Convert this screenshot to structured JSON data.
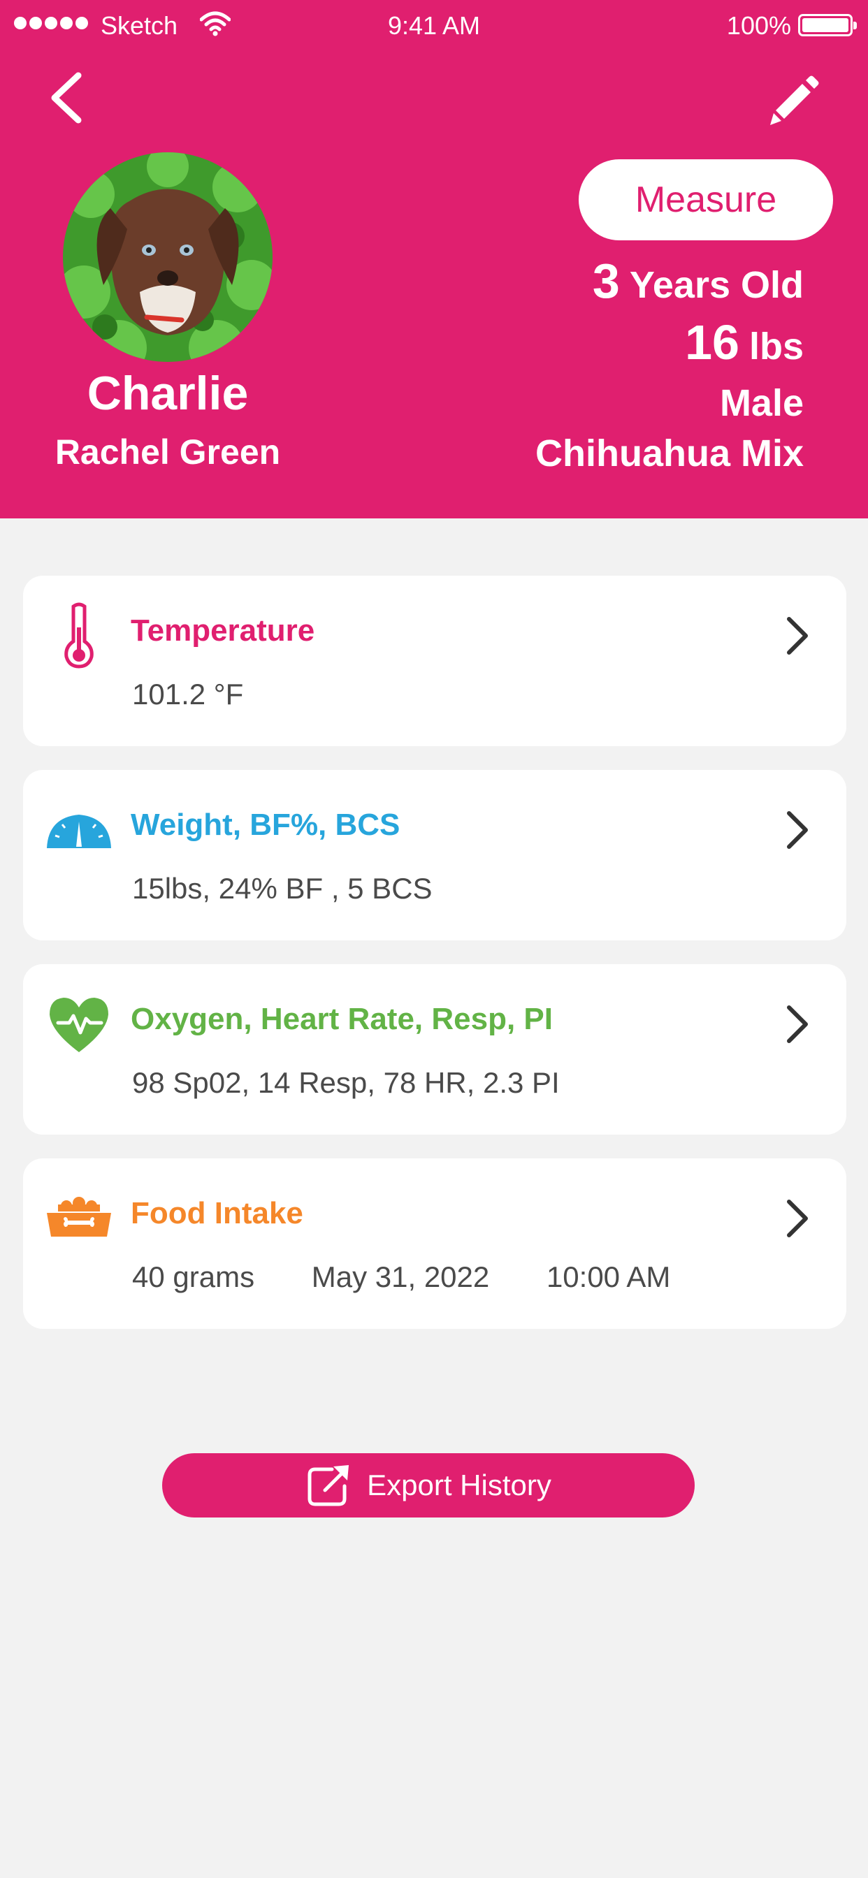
{
  "status_bar": {
    "carrier": "Sketch",
    "time": "9:41 AM",
    "battery": "100%"
  },
  "header": {
    "background": "#e01f6f",
    "measure_label": "Measure",
    "pet": {
      "name": "Charlie",
      "owner": "Rachel Green",
      "age_number": "3",
      "age_unit": "Years Old",
      "weight_number": "16",
      "weight_unit": "lbs",
      "sex": "Male",
      "breed": "Chihuahua Mix"
    }
  },
  "cards": [
    {
      "title": "Temperature",
      "detail": "101.2 °F",
      "icon": "thermometer-icon",
      "color": "#e01f6f"
    },
    {
      "title": "Weight, BF%, BCS",
      "detail": "15lbs, 24% BF , 5 BCS",
      "icon": "scale-gauge-icon",
      "color": "#27a5dc"
    },
    {
      "title": "Oxygen, Heart Rate, Resp, PI",
      "detail": "98 Sp02, 14 Resp, 78 HR, 2.3 PI",
      "icon": "heart-pulse-icon",
      "color": "#62b346"
    },
    {
      "title": "Food Intake",
      "detail": "40 grams       May 31, 2022       10:00 AM",
      "icon": "food-bowl-icon",
      "color": "#f5872a"
    }
  ],
  "export_label": "Export History"
}
